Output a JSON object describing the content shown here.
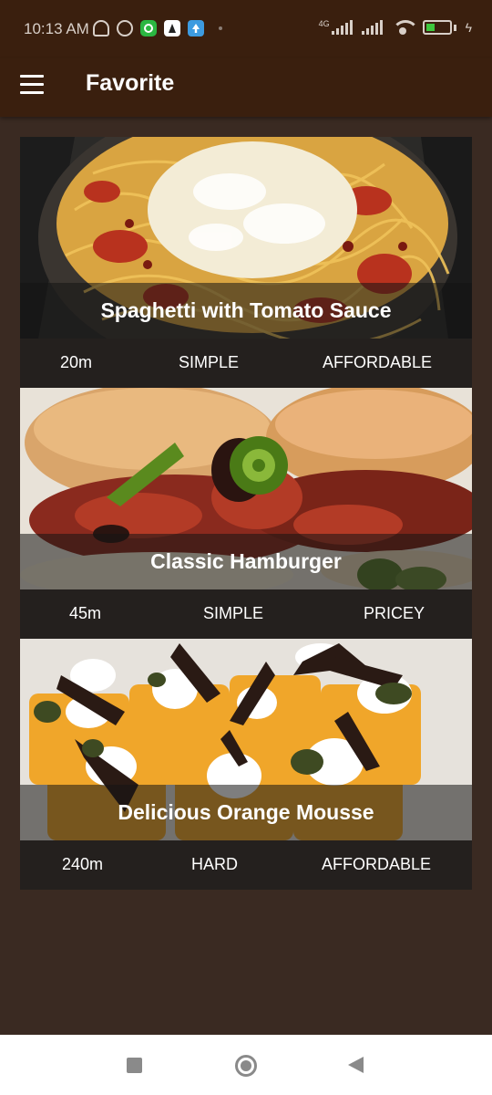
{
  "status_bar": {
    "time": "10:13 AM",
    "network": "4G",
    "battery_level": 0.41,
    "icons": [
      "mute-bell-icon",
      "alarm-icon",
      "whatsapp-icon",
      "app-icon",
      "upload-icon",
      "signal-icon",
      "wifi-icon",
      "battery-icon"
    ]
  },
  "app_bar": {
    "title": "Favorite",
    "menu_icon": "hamburger-menu-icon"
  },
  "meals": [
    {
      "title": "Spaghetti with Tomato Sauce",
      "duration": "20m",
      "complexity": "SIMPLE",
      "affordability": "AFFORDABLE"
    },
    {
      "title": "Classic Hamburger",
      "duration": "45m",
      "complexity": "SIMPLE",
      "affordability": "PRICEY"
    },
    {
      "title": "Delicious Orange Mousse",
      "duration": "240m",
      "complexity": "HARD",
      "affordability": "AFFORDABLE"
    }
  ],
  "colors": {
    "app_bar": "#3a1f0e",
    "background": "#3a2a22",
    "info_bar": "#24201e",
    "title_overlay": "rgba(20,20,20,0.55)"
  },
  "nav_bar": {
    "icons": [
      "recents-square-icon",
      "home-circle-icon",
      "back-triangle-icon"
    ]
  }
}
